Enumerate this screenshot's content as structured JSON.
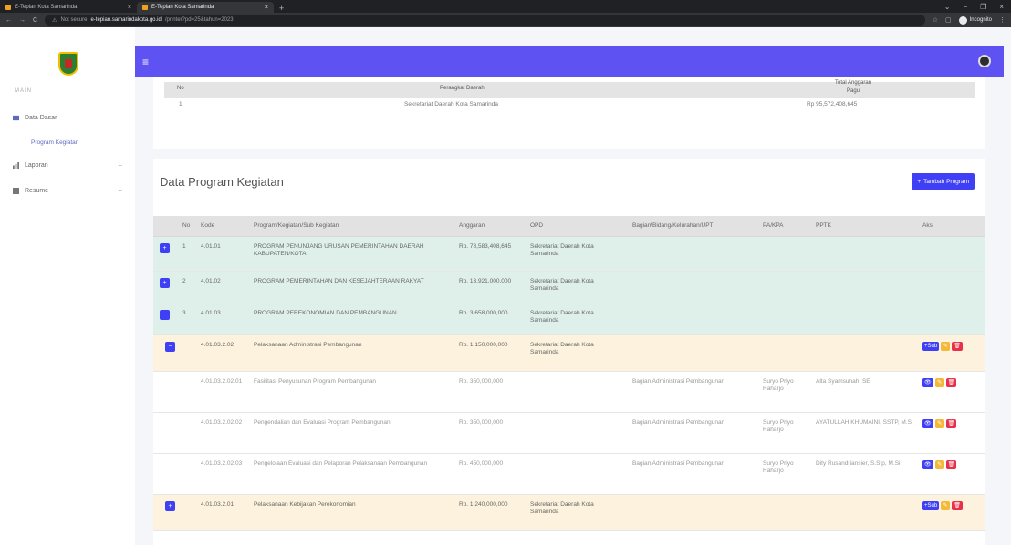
{
  "browser": {
    "tabs": [
      {
        "label": "E-Tepian Kota Samarinda"
      },
      {
        "label": "E-Tepian Kota Samarinda"
      }
    ],
    "new_tab": "+",
    "security": "Not secure",
    "url_host": "e-tepian.samarindakota.go.id",
    "url_path": "/printer?pd=25&tahun=2023",
    "profile": "Incognito"
  },
  "sidebar": {
    "heading": "MAIN",
    "items": [
      {
        "label": "Data Dasar",
        "chevron": "−",
        "icon": "folder-icon"
      },
      {
        "label": "Laporan",
        "chevron": "+",
        "icon": "chart-icon"
      },
      {
        "label": "Resume",
        "chevron": "+",
        "icon": "grid-icon"
      }
    ],
    "sub_item": "Program Kegiatan"
  },
  "summary": {
    "headers": {
      "no": "No",
      "perangkat": "Perangkat Daerah",
      "total": "Total Anggaran",
      "pagu": "Pagu"
    },
    "row": {
      "no": "1",
      "perangkat": "Sekretariat Daerah Kota Samarinda",
      "pagu": "Rp 95,572,408,645"
    }
  },
  "main": {
    "title": "Data Program Kegiatan",
    "add_button": "Tambah Program",
    "headers": [
      "No",
      "Kode",
      "Program/Kegiatan/Sub Kegiatan",
      "Anggaran",
      "OPD",
      "Bagian/Bidang/Kelurahan/UPT",
      "PA/KPA",
      "PPTK",
      "Aksi"
    ],
    "rows": [
      {
        "level": 1,
        "toggle": "+",
        "no": "1",
        "kode": "4.01.01",
        "nama": "PROGRAM PENUNJANG URUSAN PEMERINTAHAN DAERAH KABUPATEN/KOTA",
        "anggaran": "Rp. 78,583,408,645",
        "opd": "Sekretariat Daerah Kota Samarinda",
        "bagian": "",
        "pa": "",
        "pptk": ""
      },
      {
        "level": 1,
        "toggle": "+",
        "no": "2",
        "kode": "4.01.02",
        "nama": "PROGRAM PEMERINTAHAN DAN KESEJAHTERAAN RAKYAT",
        "anggaran": "Rp. 13,921,000,000",
        "opd": "Sekretariat Daerah Kota Samarinda",
        "bagian": "",
        "pa": "",
        "pptk": ""
      },
      {
        "level": 1,
        "toggle": "−",
        "no": "3",
        "kode": "4.01.03",
        "nama": "PROGRAM PEREKONOMIAN DAN PEMBANGUNAN",
        "anggaran": "Rp. 3,658,000,000",
        "opd": "Sekretariat Daerah Kota Samarinda",
        "bagian": "",
        "pa": "",
        "pptk": ""
      },
      {
        "level": 2,
        "toggle": "−",
        "no": "",
        "kode": "4.01.03.2.02",
        "nama": "Pelaksanaan Administrasi Pembangunan",
        "anggaran": "Rp. 1,150,000,000",
        "opd": "Sekretariat Daerah Kota Samarinda",
        "bagian": "",
        "pa": "",
        "pptk": "",
        "actions": [
          "+Sub",
          "✎",
          "🗑"
        ]
      },
      {
        "level": 3,
        "toggle": "",
        "no": "",
        "kode": "4.01.03.2.02.01",
        "nama": "Fasilitasi Penyusunan Program Pembangunan",
        "anggaran": "Rp. 350,000,000",
        "opd": "",
        "bagian": "Bagian Administrasi Pembangunan",
        "pa": "Suryo Priyo Raharjo",
        "pptk": "Alta Syamsunah, SE",
        "actions": [
          "👁",
          "✎",
          "🗑"
        ]
      },
      {
        "level": 3,
        "toggle": "",
        "no": "",
        "kode": "4.01.03.2.02.02",
        "nama": "Pengendalian dan Evaluasi Program Pembangunan",
        "anggaran": "Rp. 350,000,000",
        "opd": "",
        "bagian": "Bagian Administrasi Pembangunan",
        "pa": "Suryo Priyo Raharjo",
        "pptk": "AYATULLAH KHUMAINI, SSTP, M.Si",
        "actions": [
          "👁",
          "✎",
          "🗑"
        ]
      },
      {
        "level": 3,
        "toggle": "",
        "no": "",
        "kode": "4.01.03.2.02.03",
        "nama": "Pengelolaan Evaluasi dan Pelaporan Pelaksanaan Pembangunan",
        "anggaran": "Rp. 450,000,000",
        "opd": "",
        "bagian": "Bagian Administrasi Pembangunan",
        "pa": "Suryo Priyo Raharjo",
        "pptk": "Dity Rusandriansier, S.Stp, M.Si",
        "actions": [
          "👁",
          "✎",
          "🗑"
        ]
      },
      {
        "level": 2,
        "toggle": "+",
        "no": "",
        "kode": "4.01.03.2.01",
        "nama": "Pelaksanaan Kebijakan Perekonomian",
        "anggaran": "Rp. 1,240,000,000",
        "opd": "Sekretariat Daerah Kota Samarinda",
        "bagian": "",
        "pa": "",
        "pptk": "",
        "actions": [
          "+Sub",
          "✎",
          "🗑"
        ]
      }
    ]
  }
}
